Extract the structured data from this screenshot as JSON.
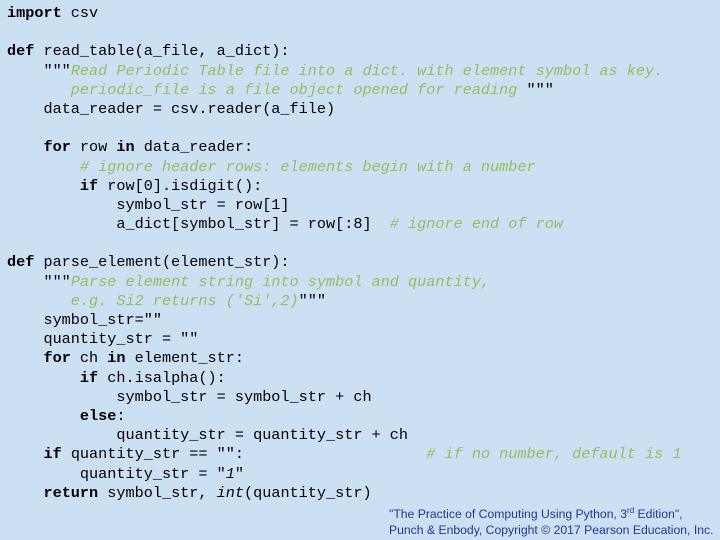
{
  "code_lines": [
    [
      [
        "kw",
        "import"
      ],
      [
        "t",
        " csv"
      ]
    ],
    [],
    [
      [
        "kw",
        "def"
      ],
      [
        "t",
        " read_table(a_file, a_dict):"
      ]
    ],
    [
      [
        "t",
        "    \"\"\""
      ],
      [
        "com",
        "Read Periodic Table file into a dict. with element symbol as key."
      ]
    ],
    [
      [
        "com",
        "       periodic_file is a file object opened for reading "
      ],
      [
        "t",
        "\"\"\""
      ]
    ],
    [
      [
        "t",
        "    data_reader = csv.reader(a_file)"
      ]
    ],
    [],
    [
      [
        "t",
        "    "
      ],
      [
        "kw",
        "for"
      ],
      [
        "t",
        " row "
      ],
      [
        "kw",
        "in"
      ],
      [
        "t",
        " data_reader:"
      ]
    ],
    [
      [
        "t",
        "        "
      ],
      [
        "com",
        "# ignore header rows: elements begin with a number"
      ]
    ],
    [
      [
        "t",
        "        "
      ],
      [
        "kw",
        "if"
      ],
      [
        "t",
        " row[0].isdigit():"
      ]
    ],
    [
      [
        "t",
        "            symbol_str = row[1]"
      ]
    ],
    [
      [
        "t",
        "            a_dict[symbol_str] = row[:8]  "
      ],
      [
        "com",
        "# ignore end of row"
      ]
    ],
    [],
    [
      [
        "kw",
        "def"
      ],
      [
        "t",
        " parse_element(element_str):"
      ]
    ],
    [
      [
        "t",
        "    \"\"\""
      ],
      [
        "com",
        "Parse element string into symbol and quantity,"
      ]
    ],
    [
      [
        "com",
        "       e.g. Si2 returns ('Si',2)"
      ],
      [
        "t",
        "\"\"\""
      ]
    ],
    [
      [
        "t",
        "    symbol_str=\"\""
      ]
    ],
    [
      [
        "t",
        "    quantity_str = \"\""
      ]
    ],
    [
      [
        "t",
        "    "
      ],
      [
        "kw",
        "for"
      ],
      [
        "t",
        " ch "
      ],
      [
        "kw",
        "in"
      ],
      [
        "t",
        " element_str:"
      ]
    ],
    [
      [
        "t",
        "        "
      ],
      [
        "kw",
        "if"
      ],
      [
        "t",
        " ch.isalpha():"
      ]
    ],
    [
      [
        "t",
        "            symbol_str = symbol_str + ch"
      ]
    ],
    [
      [
        "t",
        "        "
      ],
      [
        "kw",
        "else"
      ],
      [
        "t",
        ":"
      ]
    ],
    [
      [
        "t",
        "            quantity_str = quantity_str + ch"
      ]
    ],
    [
      [
        "t",
        "    "
      ],
      [
        "kw",
        "if"
      ],
      [
        "t",
        " quantity_str == \"\":                    "
      ],
      [
        "com",
        "# if no number, default is 1"
      ]
    ],
    [
      [
        "t",
        "        quantity_str = \""
      ],
      [
        "bi",
        "1"
      ],
      [
        "t",
        "\""
      ]
    ],
    [
      [
        "t",
        "    "
      ],
      [
        "kw",
        "return"
      ],
      [
        "t",
        " symbol_str, "
      ],
      [
        "bi",
        "int"
      ],
      [
        "t",
        "(quantity_str)"
      ]
    ]
  ],
  "footer": {
    "line1_pre": "\"The Practice of Computing Using Python, 3",
    "line1_sup": "rd",
    "line1_post": " Edition\",",
    "line2": "Punch & Enbody, Copyright © 2017 Pearson Education, Inc."
  },
  "colors": {
    "background": "#cce0f3",
    "keyword": "#000000",
    "comment": "#8fbf5e",
    "footer_text": "#1f3a8a"
  }
}
